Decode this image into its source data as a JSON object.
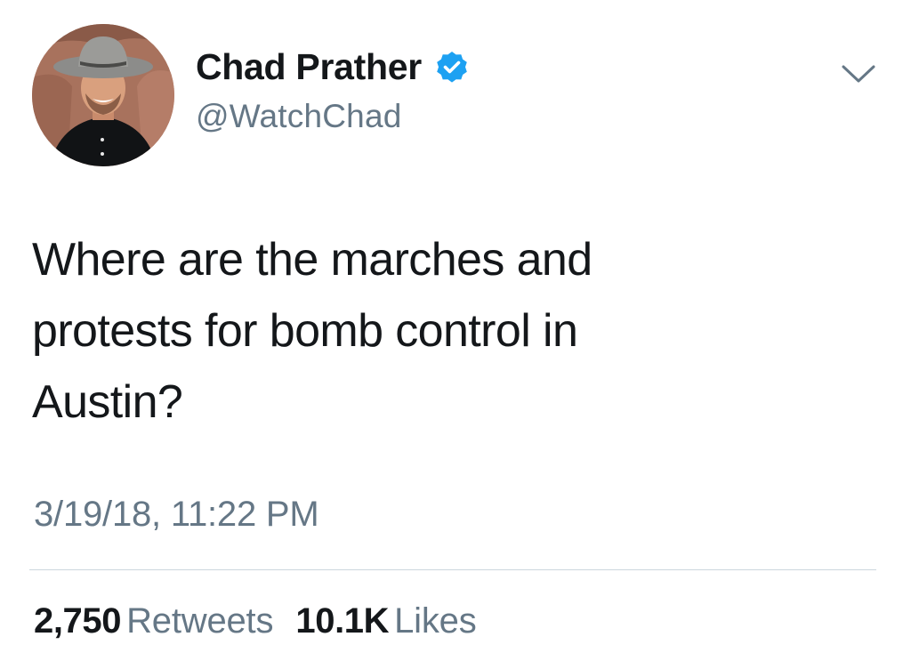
{
  "tweet": {
    "author": {
      "display_name": "Chad Prather",
      "handle": "@WatchChad",
      "verified": true,
      "avatar_icon": "profile-photo-man-in-cowboy-hat"
    },
    "text_lines": [
      "Where are the marches and",
      "protests for bomb control in",
      "Austin?"
    ],
    "timestamp": "3/19/18, 11:22 PM",
    "stats": {
      "retweets": {
        "count": "2,750",
        "label": "Retweets"
      },
      "likes": {
        "count": "10.1K",
        "label": "Likes"
      }
    },
    "menu_icon": "chevron-down-icon"
  },
  "colors": {
    "text_primary": "#14171a",
    "text_secondary": "#657786",
    "verified_badge": "#1da1f2",
    "divider": "#ccd6dd"
  }
}
